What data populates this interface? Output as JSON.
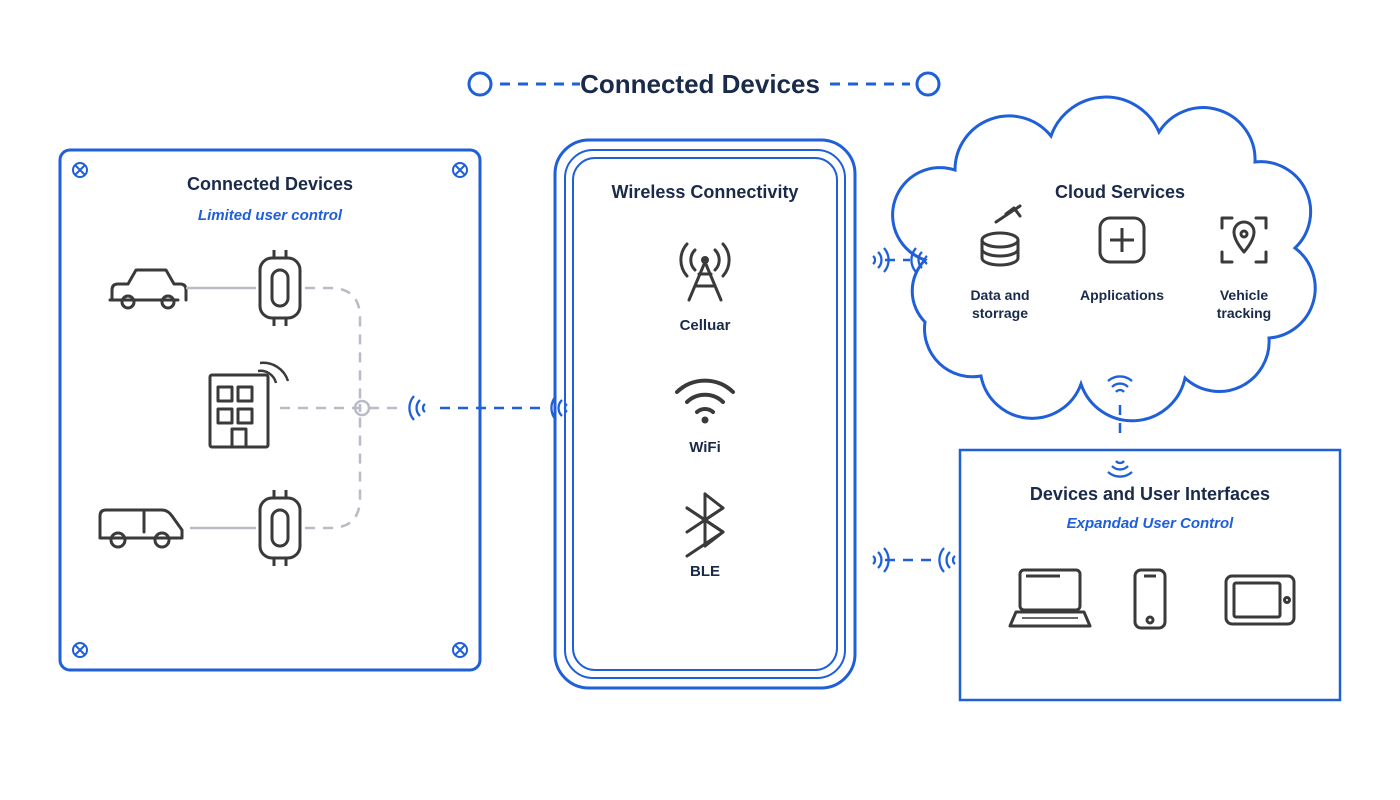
{
  "title": "Connected Devices",
  "panel_devices": {
    "title": "Connected Devices",
    "subtitle": "Limited user control"
  },
  "panel_wireless": {
    "title": "Wireless Connectivity",
    "items": {
      "cellular": "Celluar",
      "wifi": "WiFi",
      "ble": "BLE"
    }
  },
  "panel_cloud": {
    "title": "Cloud Services",
    "items": {
      "data": "Data and storrage",
      "apps": "Applications",
      "track": "Vehicle tracking"
    }
  },
  "panel_ui": {
    "title": "Devices and User Interfaces",
    "subtitle": "Expandad User Control"
  }
}
